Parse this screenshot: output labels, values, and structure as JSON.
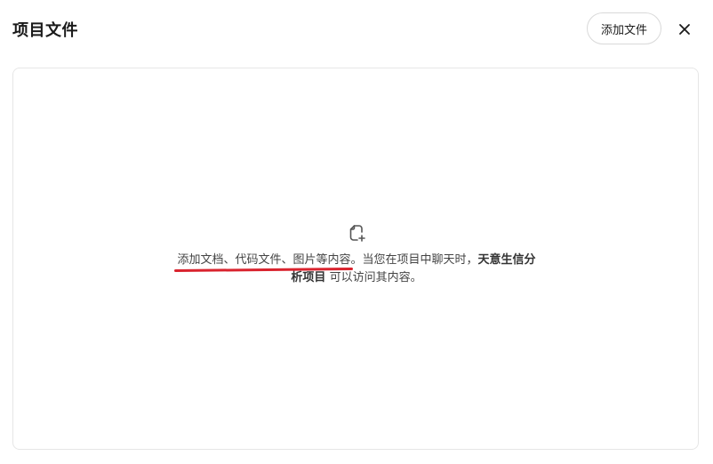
{
  "header": {
    "title": "项目文件",
    "add_button_label": "添加文件",
    "close_icon": "close-icon"
  },
  "empty_state": {
    "icon": "add-file-icon",
    "link_text": "添加文档、代码文件、图片等内容",
    "text_after_link": "。当您在项目中聊天时，",
    "project_name": "天意生信分析项目",
    "text_end": " 可以访问其内容。"
  },
  "colors": {
    "annotation_underline": "#d9232e",
    "border": "#e6e6e6",
    "text": "#444444"
  }
}
